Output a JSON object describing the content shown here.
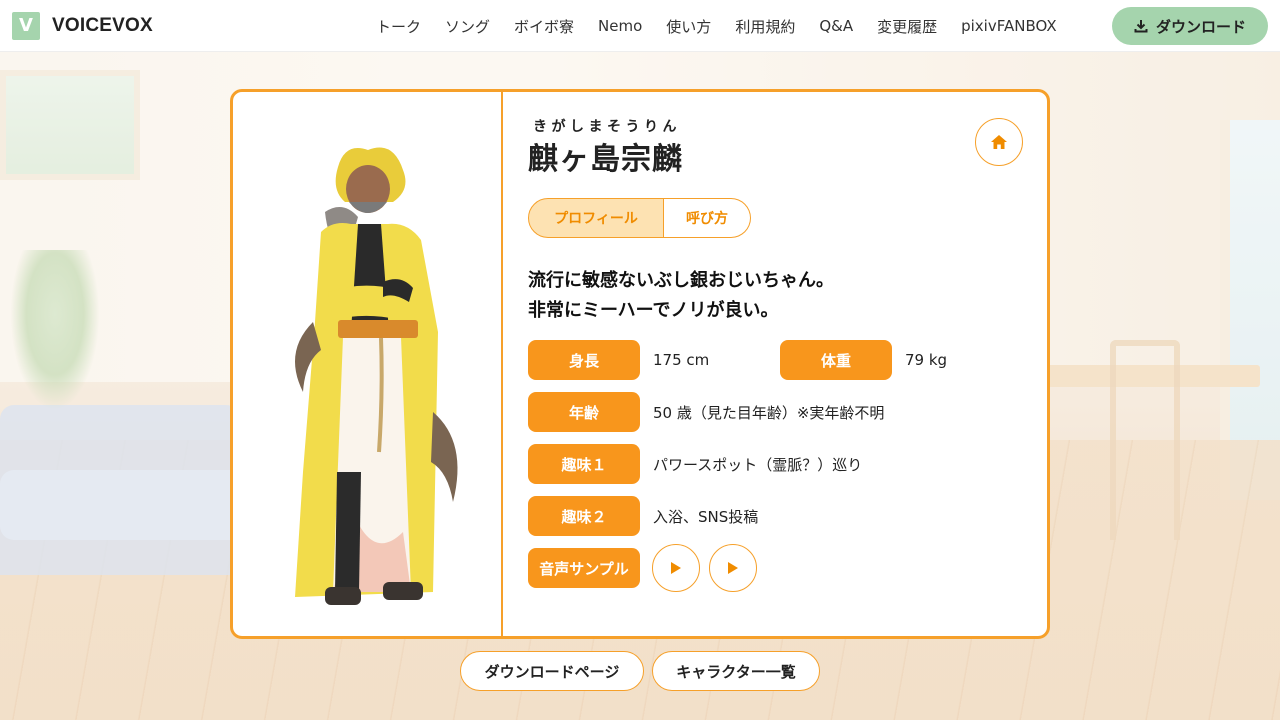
{
  "header": {
    "logo_letter": "V",
    "brand": "VOICEVOX",
    "nav": [
      "トーク",
      "ソング",
      "ボイボ寮",
      "Nemo",
      "使い方",
      "利用規約",
      "Q&A",
      "変更履歴",
      "pixivFANBOX"
    ],
    "download_label": "ダウンロード"
  },
  "character": {
    "ruby": "きがしまそうりん",
    "name": "麒ヶ島宗麟",
    "tabs": [
      {
        "label": "プロフィール",
        "active": true
      },
      {
        "label": "呼び方",
        "active": false
      }
    ],
    "catchphrase": [
      "流行に敏感ないぶし銀おじいちゃん。",
      "非常にミーハーでノリが良い。"
    ],
    "profile": {
      "height_label": "身長",
      "height_value": "175 cm",
      "weight_label": "体重",
      "weight_value": "79 kg",
      "age_label": "年齢",
      "age_value": "50 歳（見た目年齢）※実年齢不明",
      "hobby1_label": "趣味１",
      "hobby1_value": "パワースポット（霊脈？）巡り",
      "hobby2_label": "趣味２",
      "hobby2_value": "入浴、SNS投稿",
      "voice_label": "音声サンプル"
    }
  },
  "footer_buttons": {
    "download_page": "ダウンロードページ",
    "character_list": "キャラクター一覧"
  },
  "colors": {
    "accent": "#f8961c",
    "accent_border": "#f6a02a",
    "tab_active_bg": "#fde2b2",
    "brand_green": "#a5d4ad"
  },
  "icons": [
    "download-icon",
    "home-icon",
    "play-icon"
  ]
}
